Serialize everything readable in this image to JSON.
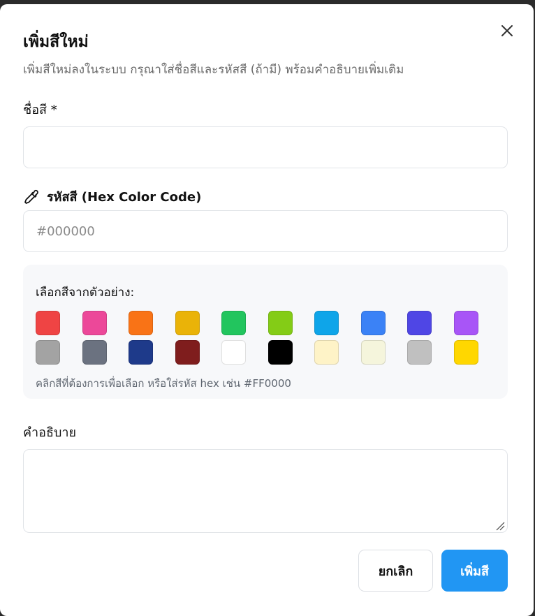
{
  "dialog": {
    "title": "เพิ่มสีใหม่",
    "subtitle": "เพิ่มสีใหม่ลงในระบบ กรุณาใส่ชื่อสีและรหัสสี (ถ้ามี) พร้อมคำอธิบายเพิ่มเติม",
    "close_icon": "close-icon"
  },
  "name_field": {
    "label": "ชื่อสี *",
    "value": "",
    "placeholder": ""
  },
  "hex_field": {
    "icon": "eyedropper-icon",
    "label": "รหัสสี (Hex Color Code)",
    "value": "",
    "placeholder": "#000000"
  },
  "swatch_panel": {
    "label": "เลือกสีจากตัวอย่าง:",
    "hint": "คลิกสีที่ต้องการเพื่อเลือก หรือใส่รหัส hex เช่น #FF0000",
    "colors": [
      "#ef4444",
      "#ec4899",
      "#f97316",
      "#eab308",
      "#22c55e",
      "#84cc16",
      "#0ea5e9",
      "#3b82f6",
      "#4f46e5",
      "#a855f7",
      "#a3a3a3",
      "#6b7280",
      "#1e3a8a",
      "#7f1d1d",
      "#ffffff",
      "#000000",
      "#fef3c7",
      "#f5f5dc",
      "#c0c0c0",
      "#ffd700"
    ]
  },
  "description_field": {
    "label": "คำอธิบาย",
    "value": ""
  },
  "actions": {
    "cancel_label": "ยกเลิก",
    "submit_label": "เพิ่มสี",
    "submit_color": "#2196f3"
  }
}
